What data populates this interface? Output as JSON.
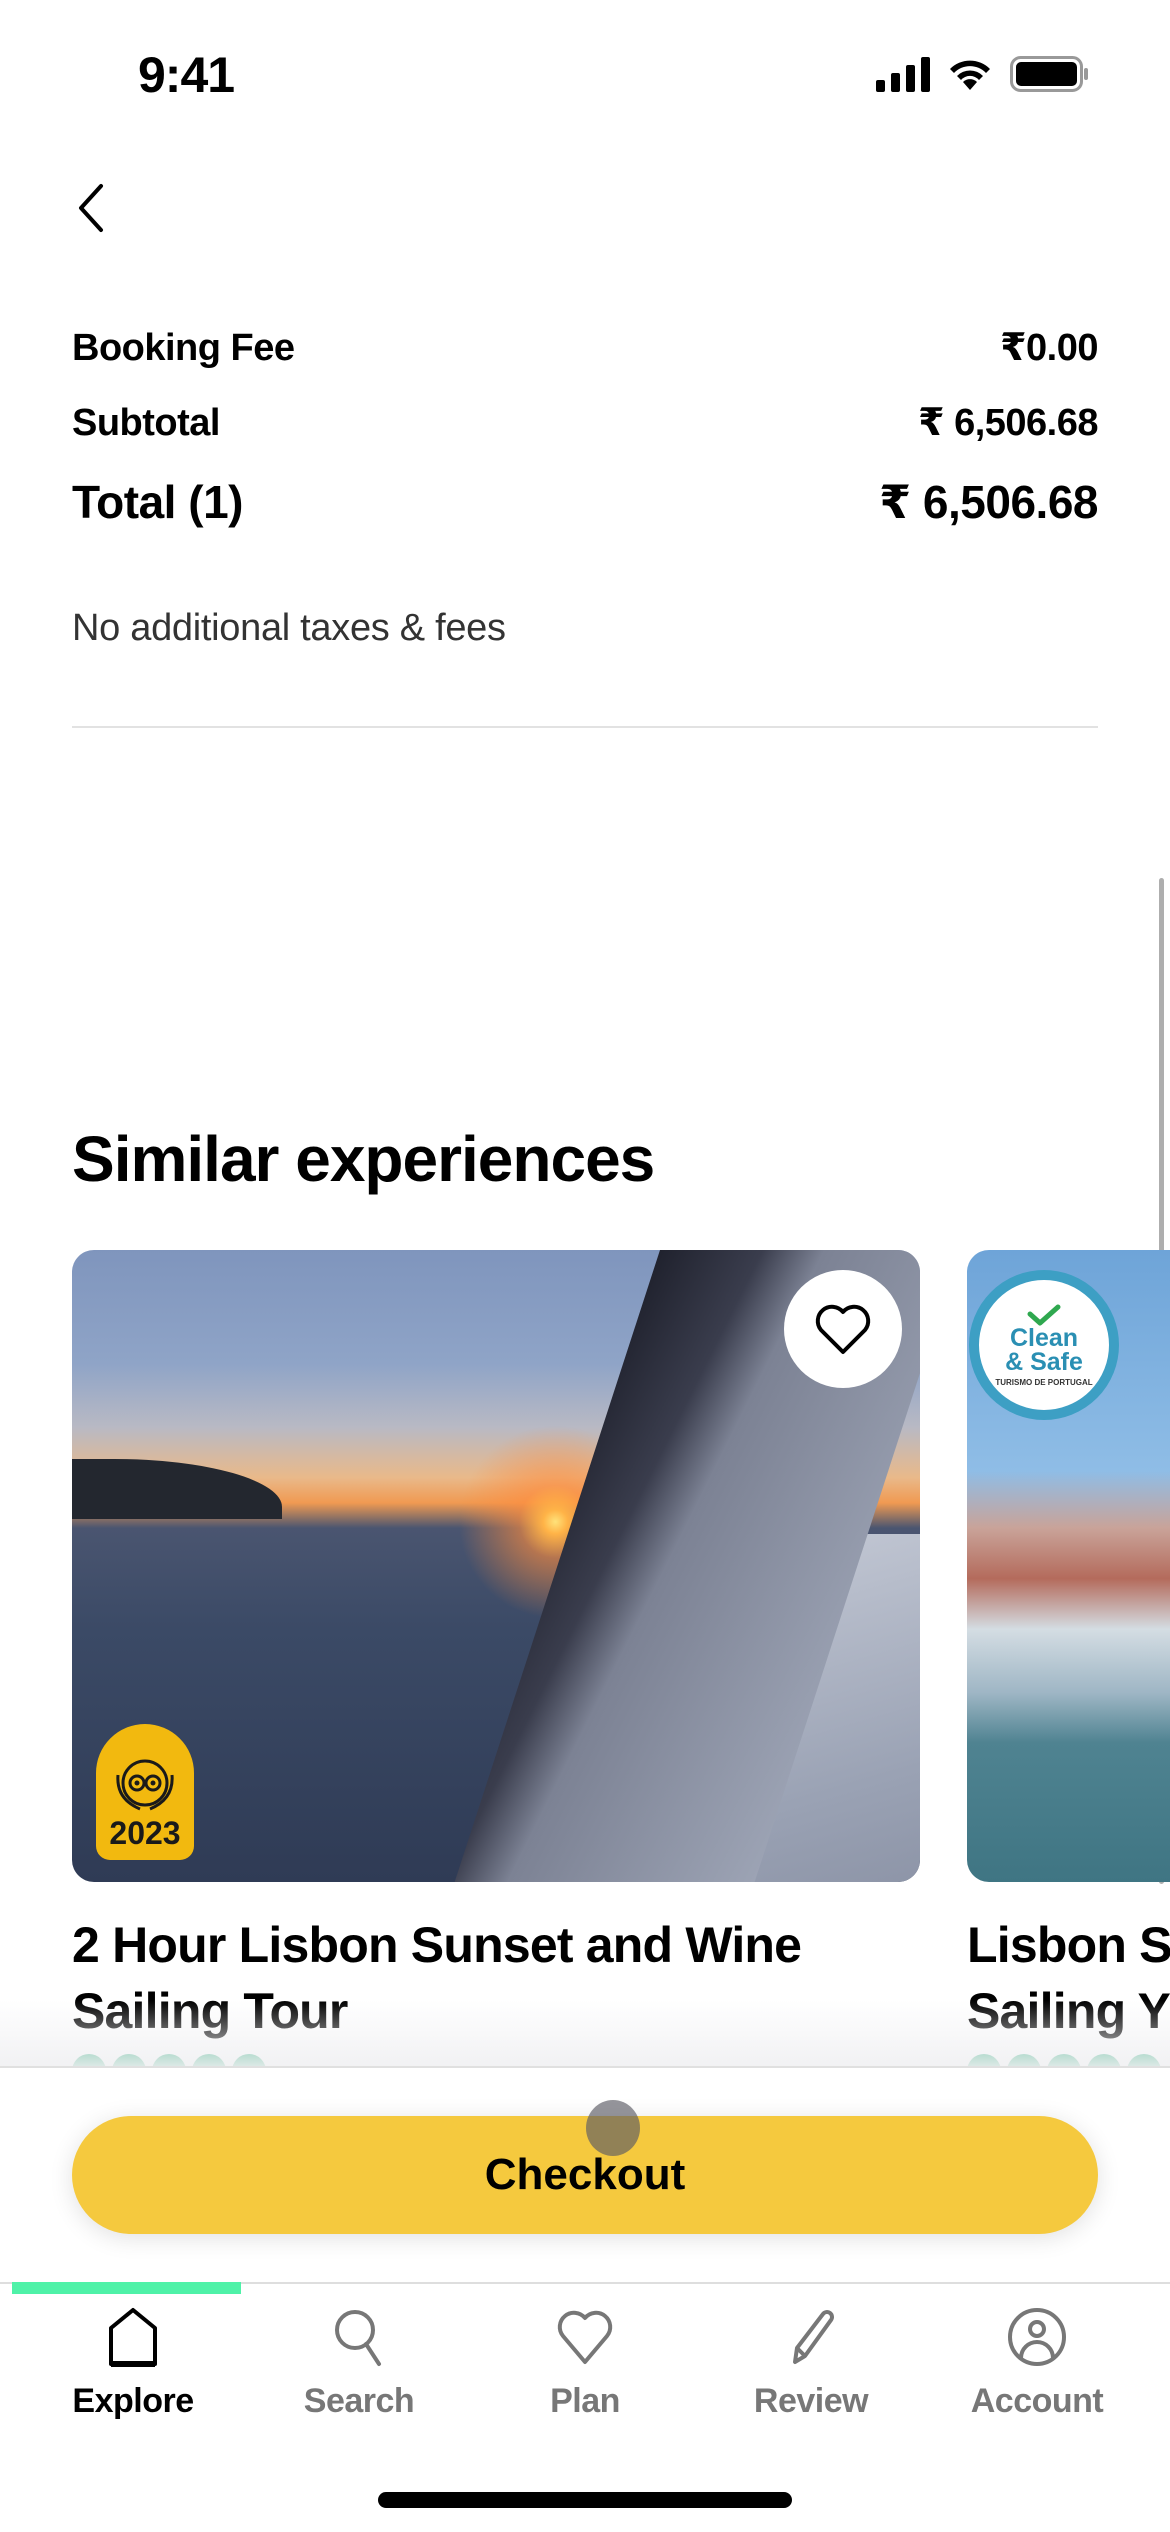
{
  "status_bar": {
    "time": "9:41"
  },
  "nav": {
    "back_icon": "chevron-left-icon"
  },
  "price_summary": {
    "booking_fee": {
      "label": "Booking Fee",
      "value": "₹0.00"
    },
    "subtotal": {
      "label": "Subtotal",
      "value": "₹ 6,506.68"
    },
    "total": {
      "label": "Total (1)",
      "value": "₹ 6,506.68"
    },
    "note": "No additional taxes & fees"
  },
  "similar": {
    "title": "Similar experiences",
    "cards": [
      {
        "title_line1": "2 Hour Lisbon Sunset and Wine",
        "title_line2": "Sailing Tour",
        "badge": "2023",
        "badge_type": "travelers-choice-award",
        "rating_bubbles": 5,
        "favorite_icon": "heart-outline-icon"
      },
      {
        "title_line1": "Lisbon S",
        "title_line2": "Sailing Y",
        "badge_line1": "Clean",
        "badge_line2": "& Safe",
        "badge_sub": "TURISMO DE PORTUGAL",
        "rating_bubbles": 5
      }
    ]
  },
  "checkout": {
    "label": "Checkout"
  },
  "tab_progress": {
    "fraction": 0.2
  },
  "tabs": [
    {
      "label": "Explore",
      "icon": "home-icon",
      "active": true
    },
    {
      "label": "Search",
      "icon": "search-icon",
      "active": false
    },
    {
      "label": "Plan",
      "icon": "heart-icon",
      "active": false
    },
    {
      "label": "Review",
      "icon": "pencil-icon",
      "active": false
    },
    {
      "label": "Account",
      "icon": "account-icon",
      "active": false
    }
  ],
  "colors": {
    "accent_yellow": "#f5c93e",
    "rating_green": "#1ea672",
    "progress_green": "#4ff2a8",
    "award_gold": "#f2b90f"
  }
}
